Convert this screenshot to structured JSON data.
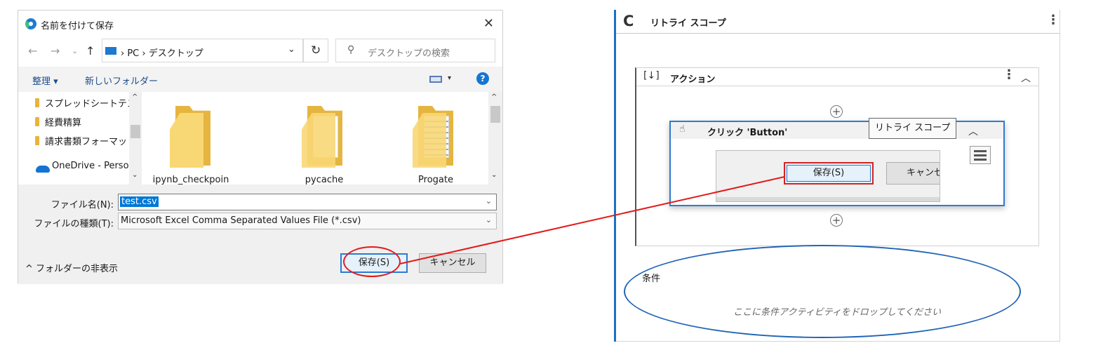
{
  "dialog": {
    "title": "名前を付けて保存",
    "close_symbol": "✕",
    "nav": {
      "back": "←",
      "forward": "→",
      "dropdown": "⌄",
      "up": "↑"
    },
    "address": {
      "path": "›  PC  ›  デスクトップ",
      "chevron": "⌄"
    },
    "refresh_symbol": "↻",
    "search": {
      "icon": "⚲",
      "placeholder": "デスクトップの検索"
    },
    "toolbar": {
      "organize": "整理 ▾",
      "new_folder": "新しいフォルダー",
      "view_chevron": "▾",
      "help": "?"
    },
    "nav_pane": {
      "items": [
        "スプレッドシートテス",
        "経費精算",
        "請求書類フォーマッ",
        "OneDrive - Person"
      ],
      "scroll_up": "^",
      "scroll_down": "⌄"
    },
    "files": [
      "ipynb_checkpoin",
      "pycache",
      "Progate"
    ],
    "form": {
      "filename_label": "ファイル名(N):",
      "filename_value": "test.csv",
      "filetype_label": "ファイルの種類(T):",
      "filetype_value": "Microsoft Excel Comma Separated Values File (*.csv)",
      "chevron": "⌄"
    },
    "hide_folders": "^ フォルダーの非表示",
    "save_button": "保存(S)",
    "cancel_button": "キャンセル"
  },
  "workflow": {
    "retry_icon": "C",
    "scope_title": "リトライ スコープ",
    "kebab": "⋮",
    "action": {
      "icon": "[↓]",
      "title": "アクション",
      "collapse": "︿"
    },
    "plus_symbol": "+",
    "click_activity": {
      "icon": "☝",
      "title": "クリック 'Button'",
      "tooltip": "リトライ スコープ",
      "preview_save": "保存(S)",
      "preview_cancel": "キャンセ"
    },
    "condition_label": "条件",
    "condition_placeholder": "ここに条件アクティビティをドロップしてください"
  },
  "colors": {
    "accent_blue": "#2f7bd0",
    "annotation_red": "#e11b1b",
    "annotation_blue": "#2065b6"
  }
}
